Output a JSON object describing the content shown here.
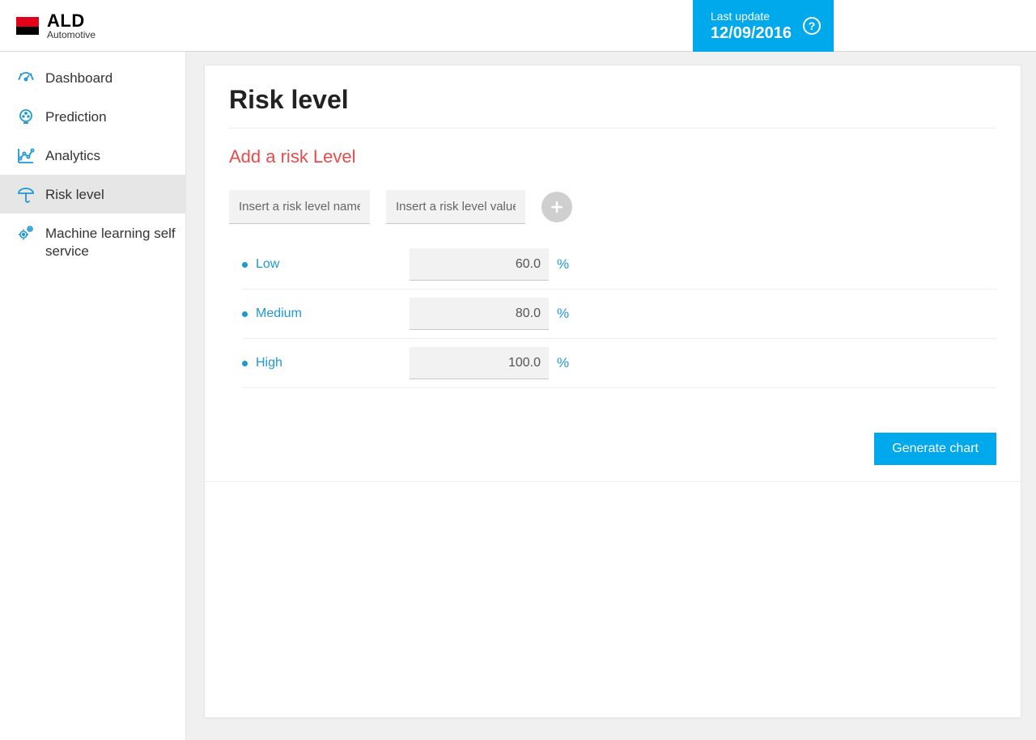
{
  "brand": {
    "line1": "ALD",
    "line2": "Automotive"
  },
  "last_update": {
    "label": "Last update",
    "date": "12/09/2016",
    "help_glyph": "?"
  },
  "sidebar": {
    "items": [
      {
        "label": "Dashboard"
      },
      {
        "label": "Prediction"
      },
      {
        "label": "Analytics"
      },
      {
        "label": "Risk level"
      },
      {
        "label": "Machine learning self service"
      }
    ]
  },
  "page": {
    "title": "Risk level",
    "subtitle": "Add a risk Level",
    "name_placeholder": "Insert a risk level name",
    "value_placeholder": "Insert a risk level value",
    "unit": "%",
    "generate_label": "Generate chart",
    "levels": [
      {
        "name": "Low",
        "value": "60.0"
      },
      {
        "name": "Medium",
        "value": "80.0"
      },
      {
        "name": "High",
        "value": "100.0"
      }
    ]
  }
}
